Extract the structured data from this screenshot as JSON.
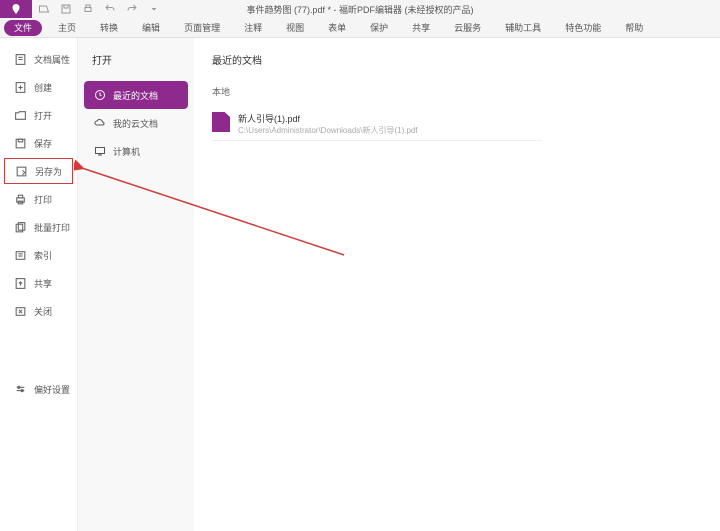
{
  "title": "事件趋势图 (77).pdf * - 福昕PDF编辑器 (未经授权的产品)",
  "ribbon": {
    "tabs": [
      "文件",
      "主页",
      "转换",
      "编辑",
      "页面管理",
      "注释",
      "视图",
      "表单",
      "保护",
      "共享",
      "云服务",
      "辅助工具",
      "特色功能",
      "帮助"
    ]
  },
  "sidebar": {
    "items": [
      {
        "label": "文档属性"
      },
      {
        "label": "创建"
      },
      {
        "label": "打开"
      },
      {
        "label": "保存"
      },
      {
        "label": "另存为"
      },
      {
        "label": "打印"
      },
      {
        "label": "批量打印"
      },
      {
        "label": "索引"
      },
      {
        "label": "共享"
      },
      {
        "label": "关闭"
      }
    ],
    "prefs": "偏好设置"
  },
  "subpanel": {
    "title": "打开",
    "items": [
      {
        "label": "最近的文档"
      },
      {
        "label": "我的云文档"
      },
      {
        "label": "计算机"
      }
    ]
  },
  "content": {
    "title": "最近的文档",
    "section": "本地",
    "file": {
      "name": "新人引导(1).pdf",
      "path": "C:\\Users\\Administrator\\Downloads\\新人引导(1).pdf"
    }
  }
}
